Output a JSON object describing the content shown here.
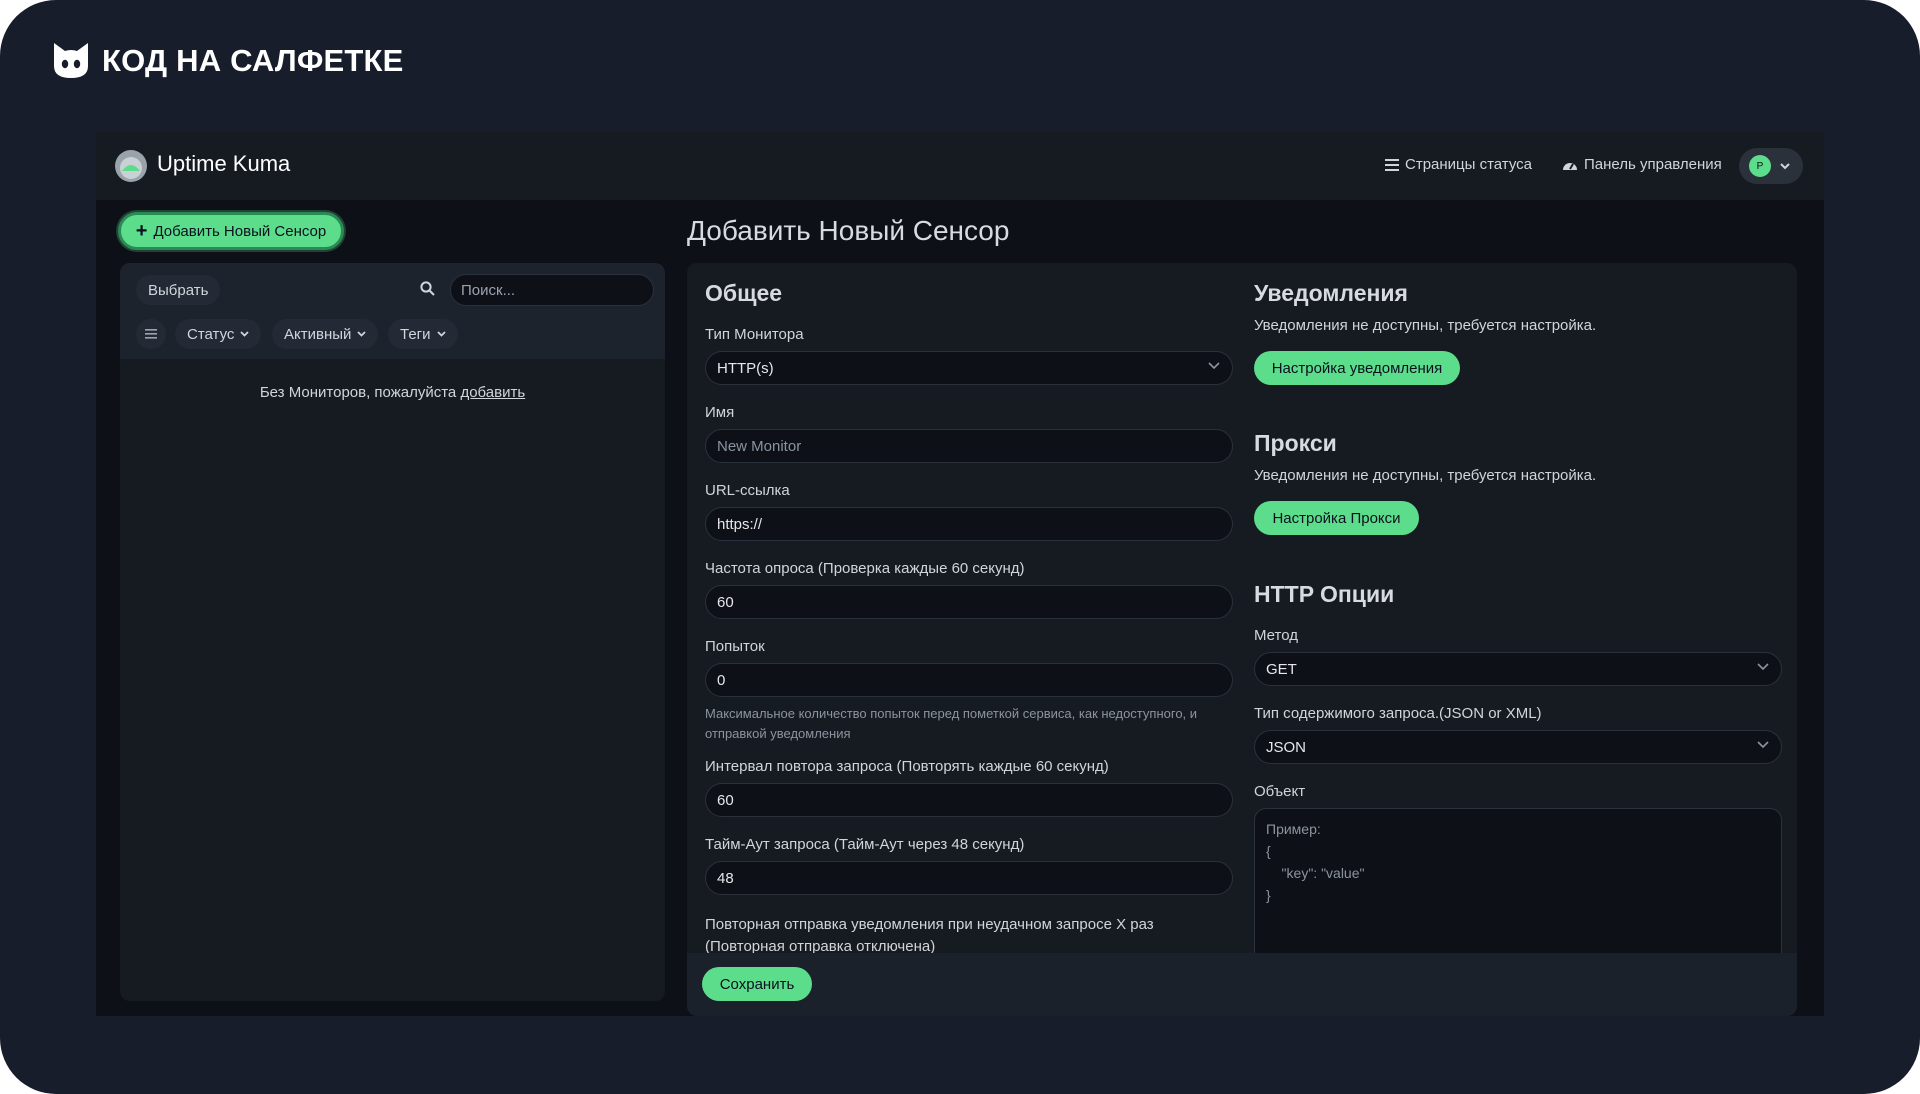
{
  "brand": {
    "name": "КОД НА САЛФЕТКЕ"
  },
  "app": {
    "title": "Uptime Kuma"
  },
  "nav": {
    "status_pages": "Страницы статуса",
    "dashboard": "Панель управления",
    "avatar_initial": "P"
  },
  "sidebar": {
    "add_button": "Добавить Новый Сенсор",
    "select_label": "Выбрать",
    "search_placeholder": "Поиск...",
    "filters": [
      "Статус",
      "Активный",
      "Теги"
    ],
    "empty_text": "Без Мониторов, пожалуйста",
    "empty_link": "добавить"
  },
  "page": {
    "title": "Добавить Новый Сенсор"
  },
  "general": {
    "heading": "Общее",
    "monitor_type_label": "Тип Монитора",
    "monitor_type_value": "HTTP(s)",
    "name_label": "Имя",
    "name_placeholder": "New Monitor",
    "url_label": "URL-ссылка",
    "url_value": "https://",
    "interval_label": "Частота опроса (Проверка каждые 60 секунд)",
    "interval_value": "60",
    "retries_label": "Попыток",
    "retries_value": "0",
    "retries_help": "Максимальное количество попыток перед пометкой сервиса, как недоступного, и отправкой уведомления",
    "retry_interval_label": "Интервал повтора запроса (Повторять каждые 60 секунд)",
    "retry_interval_value": "60",
    "timeout_label": "Тайм-Аут запроса (Тайм-Аут через 48 секунд)",
    "timeout_value": "48",
    "resend_label": "Повторная отправка уведомления при неудачном запросе X раз (Повторная отправка отключена)"
  },
  "notifications": {
    "heading": "Уведомления",
    "text": "Уведомления не доступны, требуется настройка.",
    "button": "Настройка уведомления"
  },
  "proxy": {
    "heading": "Прокси",
    "text": "Уведомления не доступны, требуется настройка.",
    "button": "Настройка Прокси"
  },
  "http_options": {
    "heading": "HTTP Опции",
    "method_label": "Метод",
    "method_value": "GET",
    "content_type_label": "Тип содержимого запроса.(JSON or XML)",
    "content_type_value": "JSON",
    "body_label": "Объект",
    "body_placeholder": "Пример:\n{\n    \"key\": \"value\"\n}"
  },
  "footer": {
    "save_button": "Сохранить"
  },
  "colors": {
    "accent": "#5cdd8b",
    "frame_bg": "#181d2b",
    "app_bg": "#0d1117",
    "panel_bg": "#161b22"
  }
}
